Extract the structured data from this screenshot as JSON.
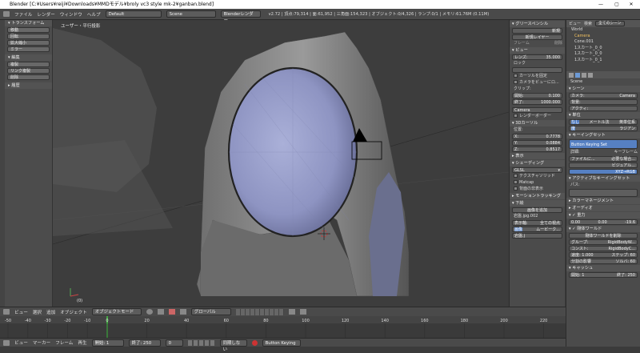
{
  "title": "Blender [C:¥Users¥reiji¥Downloads¥MMDモデル¥broly vc3 style mk-2¥ganban.blend]",
  "window_controls": [
    "—",
    "▢",
    "✕"
  ],
  "menus": [
    "ファイル",
    "レンダー",
    "ウィンドウ",
    "ヘルプ"
  ],
  "layout": "Default",
  "scene": "Scene",
  "engine": "Blenderレンダー",
  "stats": "v2.72 | 頂点:79,314 | 面:61,952 | 三角面:154,323 | オブジェクト:0/4,326 | ランプ:0/1 | メモリ:61.76M (0.11M)",
  "viewport_label": "ユーザー・平行投影",
  "viewport_frame": "(0)",
  "toolshelf": {
    "transform_header": "▾ トランスフォーム",
    "transform_buttons": [
      "移動",
      "回転",
      "拡大縮小",
      "ミラー"
    ],
    "edit_header": "▾ 編集",
    "edit_buttons": [
      "複製",
      "リンク複製",
      "削除"
    ],
    "history_header": "▸ 履歴"
  },
  "props": {
    "grease_header": "▾ グリースペンシル",
    "new_btn": "新規",
    "new_layer": "新規レイヤー",
    "frame_label": "フレーム",
    "delete_label": "削除",
    "view_header": "▾ ビュー",
    "lens_label": "レンズ:",
    "lens_value": "35.000",
    "lock_label": "ロック",
    "cursor_label": "カーソルを固定",
    "camera_lock": "カメラをビューにロ...",
    "clip_label": "クリップ:",
    "clip_start_label": "開始:",
    "clip_start": "0.100",
    "clip_end_label": "終了:",
    "clip_end": "1000.000",
    "camera_field": "Camera",
    "render_border": "レンダーボーダー",
    "cursor3d_header": "▾ 3Dカーソル",
    "location_label": "位置:",
    "x_label": "X:",
    "x_val": "0.7778",
    "y_label": "Y:",
    "y_val": "0.0884",
    "z_label": "Z:",
    "z_val": "0.8517",
    "display_header": "▸ 表示",
    "shading_header": "▾ シェーディング",
    "glsl": "GLSL",
    "texture_solid": "テクスチャソリッド",
    "matcap": "Matcap",
    "backface": "背面の非表示",
    "motion_header": "▸ モーショントラッキング",
    "bg_header": "▾ 下絵",
    "add_image": "画像を追加",
    "image_name": "岩盤.jpg.002",
    "axis_label": "表示軸:",
    "axis_value": "全ての視点",
    "image_tab": "画像",
    "movie_tab": "ムービーク...",
    "open_label": "岩盤.j"
  },
  "outliner": {
    "view_label": "ビュー",
    "search_label": "検索",
    "all_scenes": "全てのシーン",
    "items": [
      "World",
      "Camera",
      "Cone.001",
      "1スカート_0_0",
      "1スカート_0_0",
      "1スカート_0_1"
    ]
  },
  "scene_panel": {
    "scene_name": "Scene",
    "scene_header": "▾ シーン",
    "camera_label": "カメラ:",
    "camera_value": "Camera",
    "bg_label": "背景:",
    "active_label": "アクティ:",
    "units_header": "▾ 単位",
    "unit_none": "なし",
    "unit_metric": "メートル法",
    "unit_imperial": "英単位系",
    "rotation_deg": "度",
    "rotation_rad": "ラジアン",
    "keying_header": "▾ キーイングセット",
    "keying_value": "Button Keying Set",
    "detail_label": "詳細:",
    "keyframe_label": "キーフレーム",
    "file_label": "ファイルに...",
    "required_label": "必要な場合...",
    "visual_label": "ビジュアル...",
    "xyz_label": "XYZ→RGB",
    "active_keying_header": "▾ アクティブなキーイングセット",
    "path_label": "パス:",
    "color_mgmt": "▸ カラーマネージメント",
    "audio": "▸ オーディオ",
    "gravity": "▾ ✓ 重力",
    "grav_x": "0.00",
    "grav_y": "0.00",
    "grav_z": "-19.6",
    "rigid_header": "▾ ✓ 剛体ワールド",
    "rigid_delete": "剛体ワールドを削除",
    "group_label": "グループ:",
    "group_value": "RigidBodyW...",
    "const_label": "コンスト:",
    "const_value": "RigidBodyC...",
    "speed_label": "速度: 1.000",
    "step_label": "ステップ: 60",
    "split_label": "分割の影響",
    "solver_label": "ソルバ: 60",
    "cache_header": "▾ キャッシュ",
    "start_label": "開始: 1",
    "end_label": "終了: 250"
  },
  "view_header": {
    "items": [
      "ビュー",
      "選択",
      "追加",
      "オブジェクト"
    ],
    "mode": "オブジェクトモード",
    "pivot": "グローバル"
  },
  "timeline": {
    "ticks": [
      "-40",
      "-20",
      "0",
      "20",
      "40",
      "60",
      "80",
      "100",
      "120",
      "140",
      "160",
      "180",
      "200",
      "220",
      "240",
      "260"
    ],
    "ticks_neg": [
      "-50",
      "-30",
      "-10"
    ],
    "menus": [
      "ビュー",
      "マーカー",
      "フレーム",
      "再生"
    ],
    "start": "開始: 1",
    "end": "終了: 250",
    "current": "0",
    "sync": "同期しない",
    "keying": "Button Keying"
  }
}
